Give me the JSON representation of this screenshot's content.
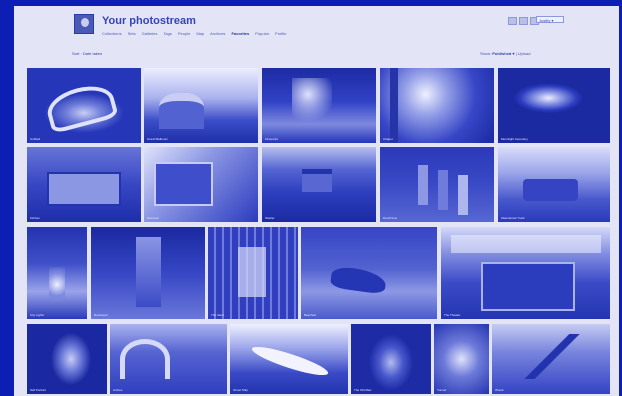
{
  "header": {
    "title": "Your photostream",
    "nav": [
      {
        "label": "Collections",
        "active": false
      },
      {
        "label": "Sets",
        "active": false
      },
      {
        "label": "Galleries",
        "active": false
      },
      {
        "label": "Tags",
        "active": false
      },
      {
        "label": "People",
        "active": false
      },
      {
        "label": "Map",
        "active": false
      },
      {
        "label": "Archives",
        "active": false
      },
      {
        "label": "Favorites",
        "active": true
      },
      {
        "label": "Popular",
        "active": false
      },
      {
        "label": "Profile",
        "active": false
      }
    ],
    "view_select": "Justify ▾",
    "view_icons": [
      "grid-small-icon",
      "grid-medium-icon",
      "grid-large-icon"
    ]
  },
  "subbar": {
    "left": "Sort · Date taken",
    "right_prefix": "Show:",
    "right_value": "Published ▾",
    "right_suffix": "| Upload"
  },
  "photos": [
    {
      "caption": "Untitled"
    },
    {
      "caption": "Grand Ballroom"
    },
    {
      "caption": "Fireworks"
    },
    {
      "caption": "Chapel"
    },
    {
      "caption": "Moonlight Cemetery"
    },
    {
      "caption": "Kitchen"
    },
    {
      "caption": "Sunroom"
    },
    {
      "caption": "Shelter"
    },
    {
      "caption": "Doorframe"
    },
    {
      "caption": "Abandoned Truck"
    },
    {
      "caption": "City Lights"
    },
    {
      "caption": "Downtown"
    },
    {
      "caption": "The Vault"
    },
    {
      "caption": "Beached"
    },
    {
      "caption": "The Theatre"
    },
    {
      "caption": "Self Portrait"
    },
    {
      "caption": "Arches"
    },
    {
      "caption": "Ghost Ship"
    },
    {
      "caption": "The Old Man"
    },
    {
      "caption": "Tunnel"
    },
    {
      "caption": "Wreck"
    }
  ]
}
